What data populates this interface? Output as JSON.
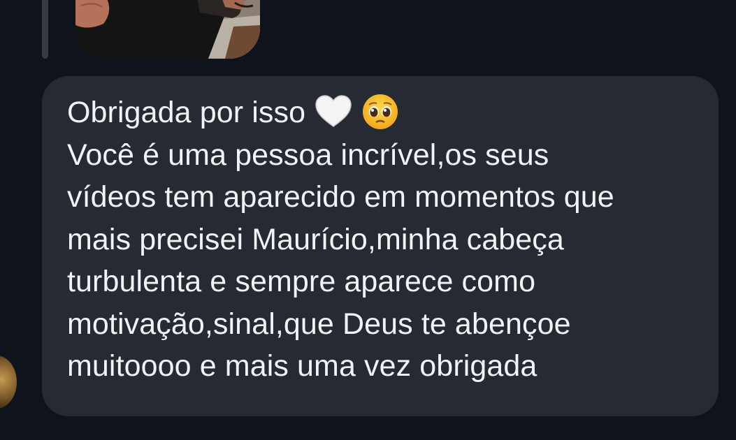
{
  "message": {
    "lines": [
      "Obrigada por isso",
      "Você é uma pessoa incrível,os seus",
      "vídeos tem aparecido em momentos que",
      "mais precisei Maurício,minha cabeça",
      "turbulenta e sempre aparece como",
      "motivação,sinal,que Deus te abençoe",
      "muitoooo e mais uma vez obrigada"
    ],
    "emojis": [
      "white-heart-icon",
      "pleading-face-icon"
    ]
  },
  "colors": {
    "background": "#0f131c",
    "bubble": "#262a33",
    "text": "#f2f3f5",
    "reply_line": "#353a44"
  }
}
